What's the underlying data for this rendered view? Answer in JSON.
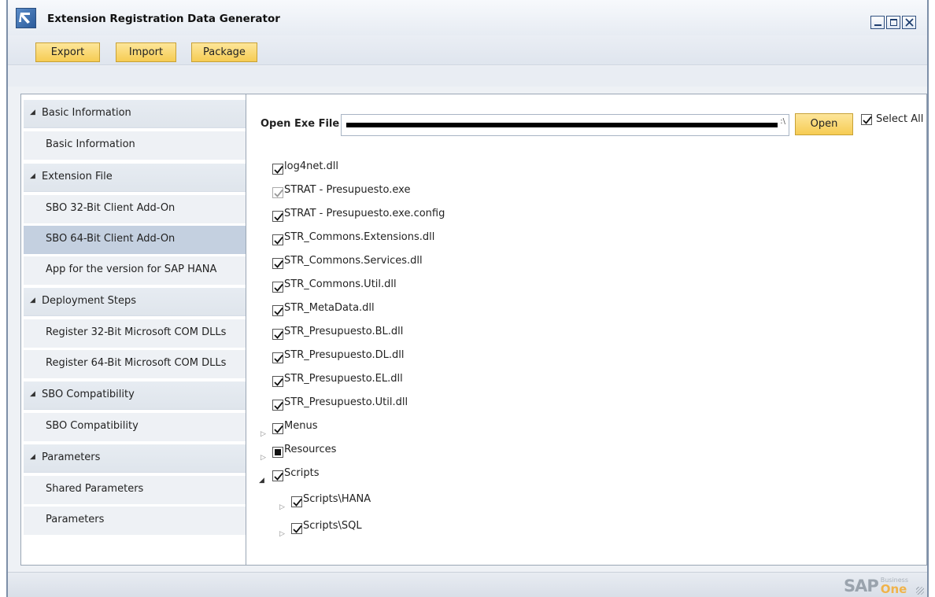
{
  "window": {
    "title": "Extension Registration Data Generator"
  },
  "toolbar": {
    "export_label": "Export",
    "import_label": "Import",
    "package_label": "Package"
  },
  "nav": {
    "groups": [
      {
        "label": "Basic Information",
        "items": [
          "Basic Information"
        ]
      },
      {
        "label": "Extension File",
        "items": [
          "SBO 32-Bit Client Add-On",
          "SBO 64-Bit Client Add-On",
          "App for the version for SAP HANA"
        ]
      },
      {
        "label": "Deployment Steps",
        "items": [
          "Register 32-Bit Microsoft COM DLLs",
          "Register 64-Bit Microsoft COM DLLs"
        ]
      },
      {
        "label": "SBO Compatibility",
        "items": [
          "SBO Compatibility"
        ]
      },
      {
        "label": "Parameters",
        "items": [
          "Shared Parameters",
          "Parameters"
        ]
      }
    ],
    "selected": "SBO 64-Bit Client Add-On"
  },
  "main": {
    "open_exe_label": "Open Exe File",
    "path_value_tail": ":\\",
    "open_button": "Open",
    "select_all_label": "Select All",
    "select_all_checked": true,
    "files": [
      {
        "name": "log4net.dll",
        "checked": true
      },
      {
        "name": "STRAT - Presupuesto.exe",
        "checked": true,
        "disabled": true
      },
      {
        "name": "STRAT - Presupuesto.exe.config",
        "checked": true
      },
      {
        "name": "STR_Commons.Extensions.dll",
        "checked": true
      },
      {
        "name": "STR_Commons.Services.dll",
        "checked": true
      },
      {
        "name": "STR_Commons.Util.dll",
        "checked": true
      },
      {
        "name": "STR_MetaData.dll",
        "checked": true
      },
      {
        "name": "STR_Presupuesto.BL.dll",
        "checked": true
      },
      {
        "name": "STR_Presupuesto.DL.dll",
        "checked": true
      },
      {
        "name": "STR_Presupuesto.EL.dll",
        "checked": true
      },
      {
        "name": "STR_Presupuesto.Util.dll",
        "checked": true
      }
    ],
    "folders": [
      {
        "name": "Menus",
        "state": "checked",
        "expanded": false
      },
      {
        "name": "Resources",
        "state": "partial",
        "expanded": false
      },
      {
        "name": "Scripts",
        "state": "checked",
        "expanded": true,
        "children": [
          {
            "name": "Scripts\\HANA",
            "state": "checked",
            "expanded": false
          },
          {
            "name": "Scripts\\SQL",
            "state": "checked",
            "expanded": false
          }
        ]
      }
    ]
  },
  "branding": {
    "sap": "SAP",
    "business": "Business",
    "one": "One"
  }
}
